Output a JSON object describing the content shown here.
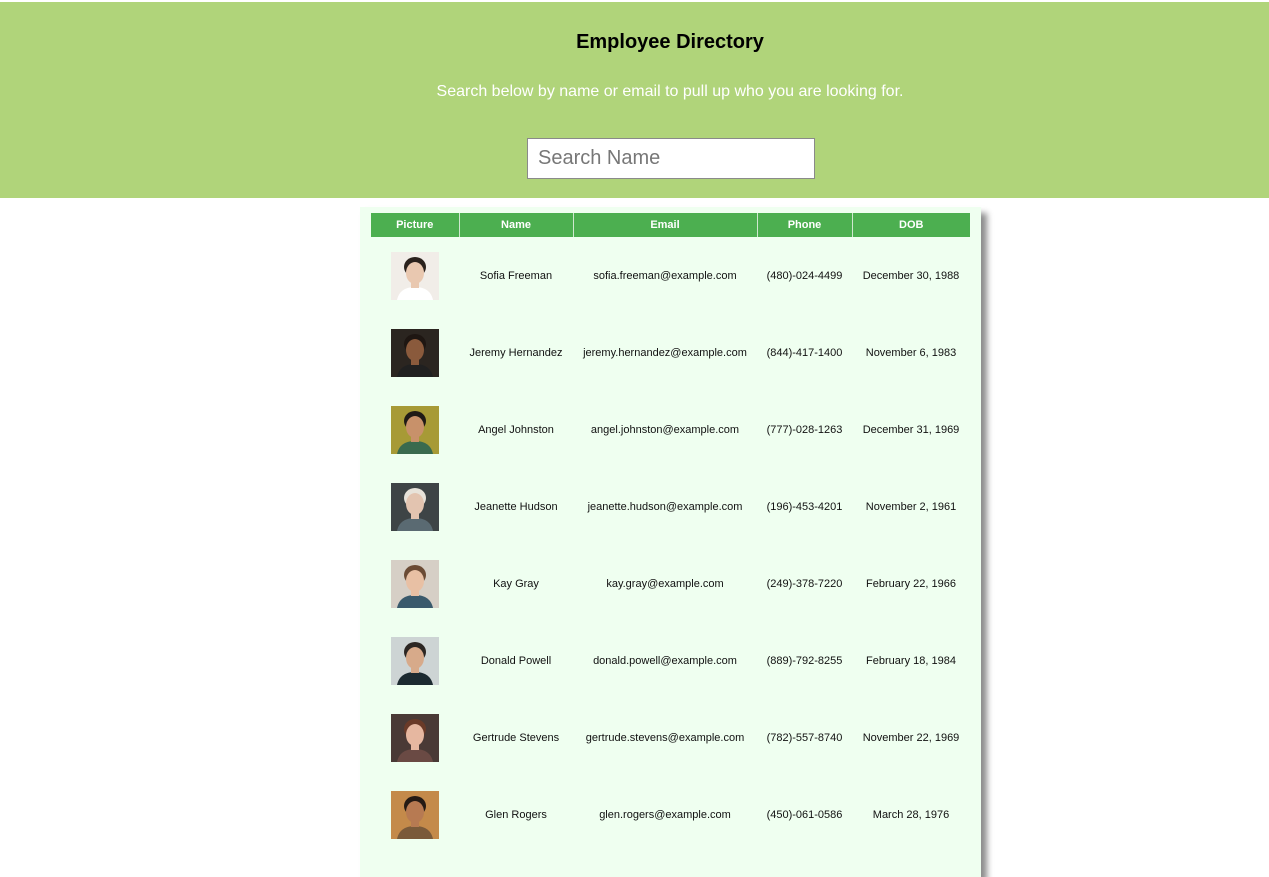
{
  "header": {
    "title": "Employee Directory",
    "subtitle": "Search below by name or email to pull up who you are looking for.",
    "search_placeholder": "Search Name",
    "search_value": ""
  },
  "table": {
    "columns": [
      "Picture",
      "Name",
      "Email",
      "Phone",
      "DOB"
    ],
    "rows": [
      {
        "name": "Sofia Freeman",
        "email": "sofia.freeman@example.com",
        "phone": "(480)-024-4499",
        "dob": "December 30, 1988",
        "avatar_icon": "person-photo-icon",
        "bg": "#f1ede8",
        "skin": "#e9c8b0",
        "hair": "#2a211c",
        "shirt": "#ffffff"
      },
      {
        "name": "Jeremy Hernandez",
        "email": "jeremy.hernandez@example.com",
        "phone": "(844)-417-1400",
        "dob": "November 6, 1983",
        "avatar_icon": "person-photo-icon",
        "bg": "#2b2520",
        "skin": "#8a5a3c",
        "hair": "#1e1612",
        "shirt": "#202020"
      },
      {
        "name": "Angel Johnston",
        "email": "angel.johnston@example.com",
        "phone": "(777)-028-1263",
        "dob": "December 31, 1969",
        "avatar_icon": "person-photo-icon",
        "bg": "#a79a36",
        "skin": "#c8916a",
        "hair": "#1f1a16",
        "shirt": "#3a6a4e"
      },
      {
        "name": "Jeanette Hudson",
        "email": "jeanette.hudson@example.com",
        "phone": "(196)-453-4201",
        "dob": "November 2, 1961",
        "avatar_icon": "person-photo-icon",
        "bg": "#3e4446",
        "skin": "#e3c4b0",
        "hair": "#e8e3da",
        "shirt": "#5a6a72"
      },
      {
        "name": "Kay Gray",
        "email": "kay.gray@example.com",
        "phone": "(249)-378-7220",
        "dob": "February 22, 1966",
        "avatar_icon": "person-photo-icon",
        "bg": "#d6cfc6",
        "skin": "#e8c0a4",
        "hair": "#6b4b35",
        "shirt": "#3a5a6c"
      },
      {
        "name": "Donald Powell",
        "email": "donald.powell@example.com",
        "phone": "(889)-792-8255",
        "dob": "February 18, 1984",
        "avatar_icon": "person-photo-icon",
        "bg": "#cdd4d4",
        "skin": "#d7aa8a",
        "hair": "#2b2622",
        "shirt": "#1c2a30"
      },
      {
        "name": "Gertrude Stevens",
        "email": "gertrude.stevens@example.com",
        "phone": "(782)-557-8740",
        "dob": "November 22, 1969",
        "avatar_icon": "person-photo-icon",
        "bg": "#4a3a36",
        "skin": "#e6b7a0",
        "hair": "#6a3a28",
        "shirt": "#6a4a44"
      },
      {
        "name": "Glen Rogers",
        "email": "glen.rogers@example.com",
        "phone": "(450)-061-0586",
        "dob": "March 28, 1976",
        "avatar_icon": "person-photo-icon",
        "bg": "#c48a4a",
        "skin": "#b77a52",
        "hair": "#241a14",
        "shirt": "#7a5a3a"
      }
    ]
  },
  "colors": {
    "header_bg": "#b0d47a",
    "table_header_bg": "#4caf50",
    "table_bg": "#effff0"
  }
}
